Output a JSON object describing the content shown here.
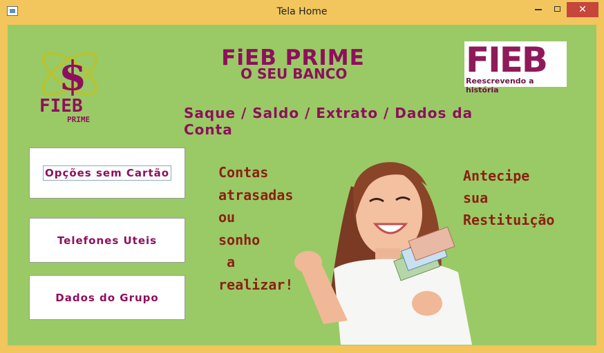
{
  "window": {
    "title": "Tela Home",
    "controls": {
      "minimize": "",
      "maximize": "",
      "close": "✕"
    }
  },
  "header": {
    "brand_title": "FiEB PRIME",
    "brand_subtitle": "O SEU BANCO",
    "services": "Saque / Saldo / Extrato / Dados da Conta"
  },
  "logos": {
    "left_text": "FIEB",
    "left_sub": "PRIME",
    "right_text": "FIEB",
    "right_tagline": "Reescrevendo a história"
  },
  "buttons": {
    "options_without_card": "Opções sem Cartão",
    "useful_phones": "Telefones Uteis",
    "group_data": "Dados do Grupo"
  },
  "promos": {
    "left": "Contas\natrasadas\nou\nsonho\n a\nrealizar!",
    "right": "Antecipe\nsua\nRestituição"
  },
  "colors": {
    "background": "#99ca66",
    "accent": "#8e0f5c",
    "promo_text": "#8b2010",
    "titlebar": "#f2c65c",
    "close_button": "#c7463b"
  }
}
